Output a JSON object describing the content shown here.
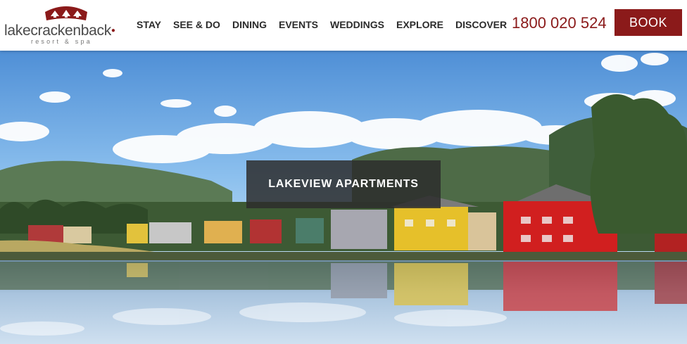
{
  "brand": {
    "name_part1": "lake",
    "name_part2": "crackenback",
    "tagline": "resort & spa",
    "logo_icon": "lodge-roofs-icon",
    "brand_color": "#8b1a1a"
  },
  "nav": {
    "items": [
      "STAY",
      "SEE & DO",
      "DINING",
      "EVENTS",
      "WEDDINGS",
      "EXPLORE",
      "DISCOVER"
    ]
  },
  "contact": {
    "phone": "1800 020 524"
  },
  "cta": {
    "book_label": "BOOK"
  },
  "hero": {
    "caption": "LAKEVIEW APARTMENTS",
    "image_subject": "lakeside apartments reflected in lake with forested mountains"
  }
}
